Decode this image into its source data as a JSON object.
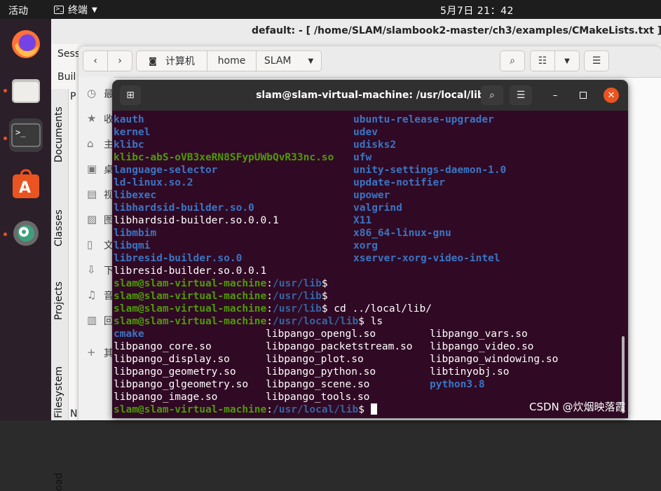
{
  "topbar": {
    "activities": "活动",
    "app_name": "终端",
    "clock": "5月7日  21：42"
  },
  "dock": {
    "items": [
      "firefox-icon",
      "files-icon",
      "terminal-icon",
      "software-icon",
      "settings-icon"
    ]
  },
  "bg_window": {
    "title": "default:   - [ /home/SLAM/slambook2-master/ch3/examples/CMakeLists.txt ] — KD",
    "menu1": "Sess",
    "menu2": "Buil",
    "vtabs": [
      "Documents",
      "Classes",
      "Projects",
      "Filesystem",
      "oad"
    ],
    "partial_p": "P",
    "partial_n": "N"
  },
  "file_manager": {
    "breadcrumbs": [
      "计算机",
      "home",
      "SLAM"
    ],
    "sidebar": [
      "最",
      "收",
      "主",
      "桌",
      "视",
      "图",
      "文",
      "下",
      "音",
      "回",
      "其"
    ]
  },
  "terminal": {
    "title": "slam@slam-virtual-machine: /usr/local/lib",
    "lines_left": [
      {
        "t": "kauth",
        "c": "blue"
      },
      {
        "t": "kernel",
        "c": "blue"
      },
      {
        "t": "klibc",
        "c": "blue"
      },
      {
        "t": "klibc-abS-oVB3xeRN8SFypUWbQvR33nc.so",
        "c": "green"
      },
      {
        "t": "language-selector",
        "c": "blue"
      },
      {
        "t": "ld-linux.so.2",
        "c": "cyan"
      },
      {
        "t": "libexec",
        "c": "blue"
      },
      {
        "t": "libhardsid-builder.so.0",
        "c": "cyan"
      },
      {
        "t": "libhardsid-builder.so.0.0.1",
        "c": "plain"
      },
      {
        "t": "libmbim",
        "c": "blue"
      },
      {
        "t": "libqmi",
        "c": "blue"
      },
      {
        "t": "libresid-builder.so.0",
        "c": "cyan"
      },
      {
        "t": "libresid-builder.so.0.0.1",
        "c": "plain"
      }
    ],
    "lines_right": [
      {
        "t": "ubuntu-release-upgrader",
        "c": "blue"
      },
      {
        "t": "udev",
        "c": "blue"
      },
      {
        "t": "udisks2",
        "c": "blue"
      },
      {
        "t": "ufw",
        "c": "blue"
      },
      {
        "t": "unity-settings-daemon-1.0",
        "c": "blue"
      },
      {
        "t": "update-notifier",
        "c": "blue"
      },
      {
        "t": "upower",
        "c": "blue"
      },
      {
        "t": "valgrind",
        "c": "blue"
      },
      {
        "t": "X11",
        "c": "blue"
      },
      {
        "t": "x86_64-linux-gnu",
        "c": "blue"
      },
      {
        "t": "xorg",
        "c": "blue"
      },
      {
        "t": "xserver-xorg-video-intel",
        "c": "blue"
      }
    ],
    "prompts": [
      {
        "user": "slam@slam-virtual-machine",
        "path": "/usr/lib",
        "cmd": ""
      },
      {
        "user": "slam@slam-virtual-machine",
        "path": "/usr/lib",
        "cmd": ""
      },
      {
        "user": "slam@slam-virtual-machine",
        "path": "/usr/lib",
        "cmd": " cd ../local/lib/"
      },
      {
        "user": "slam@slam-virtual-machine",
        "path": "/usr/local/lib",
        "cmd": " ls"
      }
    ],
    "ls_grid": [
      [
        {
          "t": "cmake",
          "c": "blue"
        },
        {
          "t": "libpango_opengl.so",
          "c": "plain"
        },
        {
          "t": "libpango_vars.so",
          "c": "plain"
        }
      ],
      [
        {
          "t": "libpango_core.so",
          "c": "plain"
        },
        {
          "t": "libpango_packetstream.so",
          "c": "plain"
        },
        {
          "t": "libpango_video.so",
          "c": "plain"
        }
      ],
      [
        {
          "t": "libpango_display.so",
          "c": "plain"
        },
        {
          "t": "libpango_plot.so",
          "c": "plain"
        },
        {
          "t": "libpango_windowing.so",
          "c": "plain"
        }
      ],
      [
        {
          "t": "libpango_geometry.so",
          "c": "plain"
        },
        {
          "t": "libpango_python.so",
          "c": "plain"
        },
        {
          "t": "libtinyobj.so",
          "c": "plain"
        }
      ],
      [
        {
          "t": "libpango_glgeometry.so",
          "c": "plain"
        },
        {
          "t": "libpango_scene.so",
          "c": "plain"
        },
        {
          "t": "python3.8",
          "c": "blue"
        }
      ],
      [
        {
          "t": "libpango_image.so",
          "c": "plain"
        },
        {
          "t": "libpango_tools.so",
          "c": "plain"
        },
        {
          "t": "",
          "c": "plain"
        }
      ]
    ],
    "final_prompt": {
      "user": "slam@slam-virtual-machine",
      "path": "/usr/local/lib"
    }
  },
  "watermark": "CSDN @炊烟映落霞",
  "colors": {
    "terminal_bg": "#300a24",
    "prompt_green": "#4e9a06",
    "dir_blue": "#3a75c4",
    "close_orange": "#e95420"
  }
}
